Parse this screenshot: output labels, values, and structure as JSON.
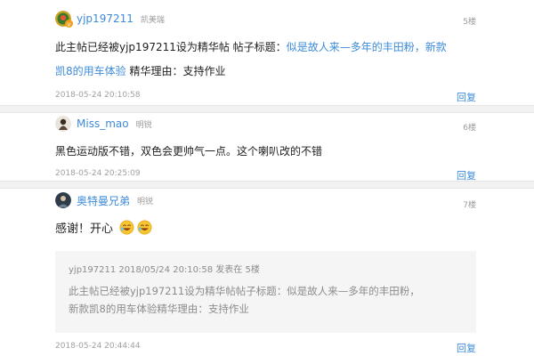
{
  "posts": [
    {
      "username": "yjp197211",
      "brand": "凯美瑞",
      "floor": "5楼",
      "content_prefix": "此主帖已经被yjp197211设为精华帖 帖子标题：",
      "content_link_1": "似是故人来—多年的丰田粉，新款",
      "content_link_2": "凯8的用车体验",
      "content_suffix": " 精华理由：支持作业",
      "timestamp": "2018-05-24 20:10:58",
      "reply_label": "回复"
    },
    {
      "username": "Miss_mao",
      "brand": "明锐",
      "floor": "6楼",
      "content": "黑色运动版不错，双色会更帅气一点。这个喇叭改的不错",
      "timestamp": "2018-05-24 20:25:09",
      "reply_label": "回复"
    },
    {
      "username": "奥特曼兄弟",
      "brand": "明锐",
      "floor": "7楼",
      "content": "感谢！开心",
      "quote": {
        "header": "yjp197211 2018/05/24 20:10:58 发表在 5楼",
        "line1": "此主帖已经被yjp197211设为精华帖帖子标题：似是故人来—多年的丰田粉，",
        "line2": "新款凯8的用车体验精华理由：支持作业"
      },
      "timestamp": "2018-05-24 20:44:44",
      "reply_label": "回复"
    }
  ],
  "colors": {
    "link": "#3d8bd8",
    "meta": "#9b9b9b",
    "divider": "#f2f2f2",
    "quote_bg": "#f5f5f5"
  }
}
